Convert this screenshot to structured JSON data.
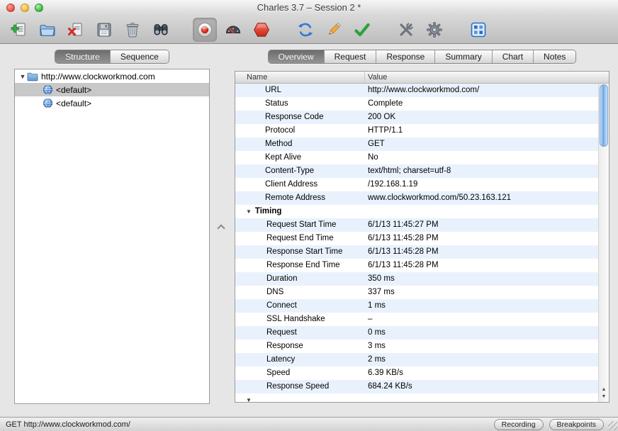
{
  "window": {
    "title": "Charles 3.7 – Session 2 *"
  },
  "toolbar": {
    "icons": [
      "add-session",
      "open-session",
      "close-session",
      "save-session",
      "clear-session",
      "find",
      "record",
      "throttle",
      "breakpoints",
      "repeat",
      "edit",
      "validate",
      "tools",
      "settings",
      "web-interface"
    ],
    "record_active": true
  },
  "left_panel": {
    "tabs": [
      {
        "label": "Structure",
        "active": true
      },
      {
        "label": "Sequence",
        "active": false
      }
    ],
    "tree": {
      "root": "http://www.clockworkmod.com",
      "children": [
        {
          "label": "<default>",
          "selected": true
        },
        {
          "label": "<default>",
          "selected": false
        }
      ]
    }
  },
  "right_panel": {
    "tabs": [
      {
        "label": "Overview",
        "active": true
      },
      {
        "label": "Request",
        "active": false
      },
      {
        "label": "Response",
        "active": false
      },
      {
        "label": "Summary",
        "active": false
      },
      {
        "label": "Chart",
        "active": false
      },
      {
        "label": "Notes",
        "active": false
      }
    ],
    "table": {
      "columns": [
        "Name",
        "Value"
      ],
      "rows": [
        {
          "name": "URL",
          "value": "http://www.clockworkmod.com/"
        },
        {
          "name": "Status",
          "value": "Complete"
        },
        {
          "name": "Response Code",
          "value": "200 OK"
        },
        {
          "name": "Protocol",
          "value": "HTTP/1.1"
        },
        {
          "name": "Method",
          "value": "GET"
        },
        {
          "name": "Kept Alive",
          "value": "No"
        },
        {
          "name": "Content-Type",
          "value": "text/html; charset=utf-8"
        },
        {
          "name": "Client Address",
          "value": "/192.168.1.19"
        },
        {
          "name": "Remote Address",
          "value": "www.clockworkmod.com/50.23.163.121"
        },
        {
          "name": "Timing",
          "value": "",
          "section": true
        },
        {
          "name": "Request Start Time",
          "value": "6/1/13 11:45:27 PM",
          "child": true
        },
        {
          "name": "Request End Time",
          "value": "6/1/13 11:45:28 PM",
          "child": true
        },
        {
          "name": "Response Start Time",
          "value": "6/1/13 11:45:28 PM",
          "child": true
        },
        {
          "name": "Response End Time",
          "value": "6/1/13 11:45:28 PM",
          "child": true
        },
        {
          "name": "Duration",
          "value": "350 ms",
          "child": true
        },
        {
          "name": "DNS",
          "value": "337 ms",
          "child": true
        },
        {
          "name": "Connect",
          "value": "1 ms",
          "child": true
        },
        {
          "name": "SSL Handshake",
          "value": "–",
          "child": true
        },
        {
          "name": "Request",
          "value": "0 ms",
          "child": true
        },
        {
          "name": "Response",
          "value": "3 ms",
          "child": true
        },
        {
          "name": "Latency",
          "value": "2 ms",
          "child": true
        },
        {
          "name": "Speed",
          "value": "6.39 KB/s",
          "child": true
        },
        {
          "name": "Response Speed",
          "value": "684.24 KB/s",
          "child": true
        },
        {
          "name": "",
          "value": "",
          "section": true
        }
      ]
    }
  },
  "status_bar": {
    "request": "GET http://www.clockworkmod.com/",
    "buttons": [
      {
        "label": "Recording"
      },
      {
        "label": "Breakpoints"
      }
    ]
  },
  "colors": {
    "row_alt": "#e9f2fc",
    "tree_selection": "#c8c8c8",
    "scroll_thumb_blue": "#6ba3e6"
  }
}
